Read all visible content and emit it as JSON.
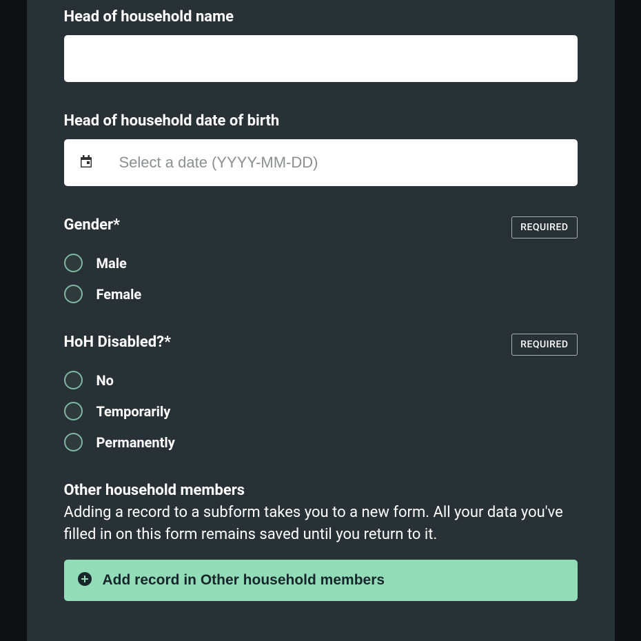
{
  "required_badge": "REQUIRED",
  "hoh_name": {
    "label": "Head of household name",
    "value": ""
  },
  "hoh_dob": {
    "label": "Head of household date of birth",
    "placeholder": "Select a date (YYYY-MM-DD)",
    "value": ""
  },
  "gender": {
    "label": "Gender*",
    "options": [
      "Male",
      "Female"
    ]
  },
  "hoh_disabled": {
    "label": "HoH Disabled?*",
    "options": [
      "No",
      "Temporarily",
      "Permanently"
    ]
  },
  "other_members": {
    "label": "Other household members",
    "helper": "Adding a record to a subform takes you to a new form. All your data you've filled in on this form remains saved until you return to it.",
    "button": "Add record in Other household members"
  }
}
